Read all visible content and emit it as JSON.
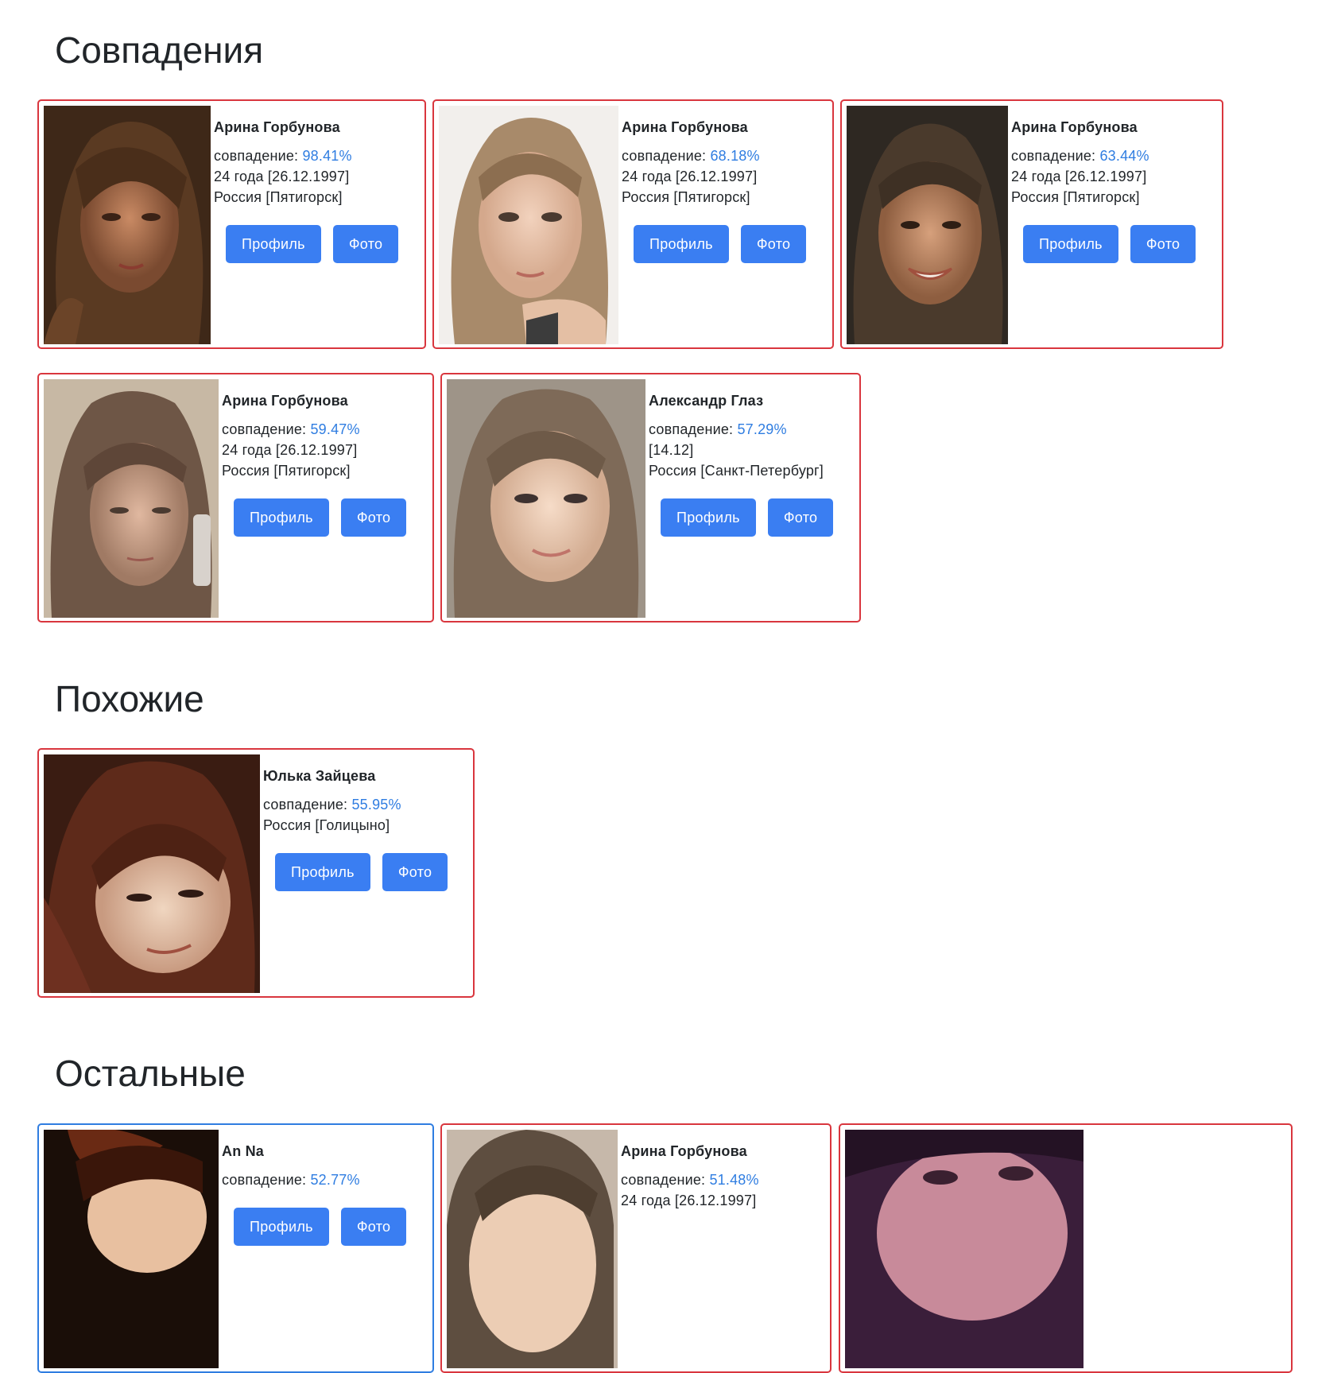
{
  "sections": [
    {
      "title": "Совпадения"
    },
    {
      "title": "Похожие"
    },
    {
      "title": "Остальные"
    }
  ],
  "labels": {
    "match_prefix": "совпадение: ",
    "profile_button": "Профиль",
    "photo_button": "Фото"
  },
  "matches": [
    {
      "name": "Арина Горбунова",
      "match": "98.41%",
      "age": "24 года [26.12.1997]",
      "location": "Россия [Пятигорск]"
    },
    {
      "name": "Арина Горбунова",
      "match": "68.18%",
      "age": "24 года [26.12.1997]",
      "location": "Россия [Пятигорск]"
    },
    {
      "name": "Арина Горбунова",
      "match": "63.44%",
      "age": "24 года [26.12.1997]",
      "location": "Россия [Пятигорск]"
    },
    {
      "name": "Арина Горбунова",
      "match": "59.47%",
      "age": "24 года [26.12.1997]",
      "location": "Россия [Пятигорск]"
    },
    {
      "name": "Александр Глаз",
      "match": "57.29%",
      "age": "[14.12]",
      "location": "Россия [Санкт-Петербург]"
    }
  ],
  "similar": [
    {
      "name": "Юлька Зайцева",
      "match": "55.95%",
      "location": "Россия [Голицыно]"
    }
  ],
  "others": [
    {
      "name": "An Na",
      "match": "52.77%"
    },
    {
      "name": "Арина Горбунова",
      "match": "51.48%",
      "age": "24 года [26.12.1997]"
    },
    {}
  ],
  "colors": {
    "accent": "#3a7ef2",
    "match_border": "#d9363e",
    "other_border": "#2f7de1",
    "percent": "#2f7de1"
  }
}
